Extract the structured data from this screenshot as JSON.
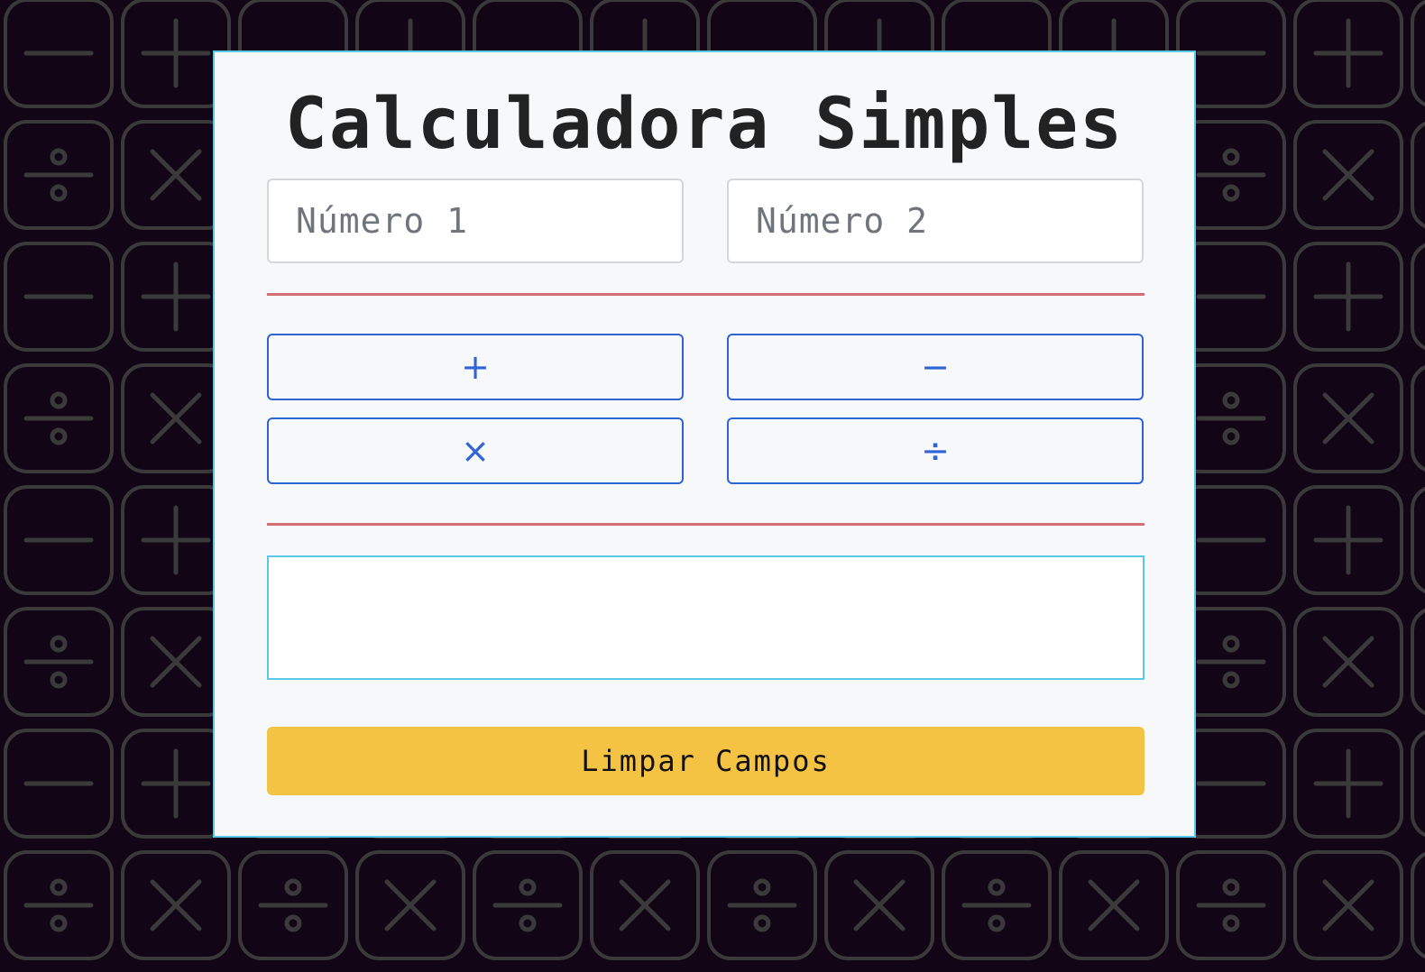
{
  "app": {
    "title": "Calculadora Simples"
  },
  "inputs": {
    "number1": {
      "placeholder": "Número 1",
      "value": ""
    },
    "number2": {
      "placeholder": "Número 2",
      "value": ""
    }
  },
  "operations": {
    "add": {
      "label": "+",
      "icon": "plus-icon"
    },
    "subtract": {
      "label": "−",
      "icon": "minus-icon"
    },
    "multiply": {
      "label": "×",
      "icon": "times-icon"
    },
    "divide": {
      "label": "÷",
      "icon": "divide-icon"
    }
  },
  "result": {
    "text": ""
  },
  "actions": {
    "clear_label": "Limpar Campos"
  },
  "background": {
    "pattern_icons": [
      "minus-icon",
      "plus-icon",
      "divide-icon",
      "times-icon"
    ]
  },
  "colors": {
    "page_background": "#120515",
    "card_background": "#f6f8fa",
    "card_border": "#5bc8e8",
    "divider": "#d46e74",
    "operation_accent": "#2f63d6",
    "clear_button": "#f5c343",
    "pattern_stroke": "#3a3a3a"
  }
}
